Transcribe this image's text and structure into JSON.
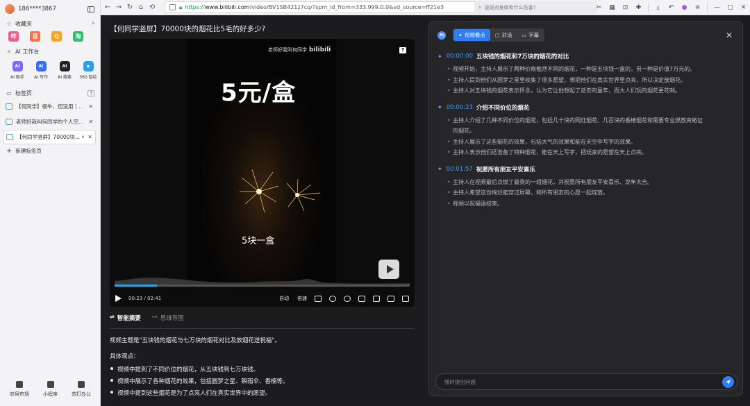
{
  "sidebar": {
    "user": "186****3867",
    "favorites_label": "收藏夹",
    "favorites": [
      {
        "icon": "bilibili-icon",
        "glyph": "哔",
        "color": "#f25d8e"
      },
      {
        "icon": "baidu-icon",
        "glyph": "百",
        "color": "#ff6f3d"
      },
      {
        "icon": "qq-icon",
        "glyph": "Q",
        "color": "#ffa21e"
      },
      {
        "icon": "taobao-icon",
        "glyph": "淘",
        "color": "#2fbf6a"
      }
    ],
    "ai_label": "AI 工作台",
    "ai_items": [
      {
        "label": "AI 助手",
        "glyph": "AI",
        "color": "#7b6cf6"
      },
      {
        "label": "AI 写作",
        "glyph": "AI",
        "color": "#3b6cf6"
      },
      {
        "label": "AI 搜索",
        "glyph": "AI",
        "color": "#222222"
      },
      {
        "label": "360 智绘",
        "glyph": "◆",
        "color": "#2b9ef0"
      }
    ],
    "tabs_label": "标签页",
    "tabs_count": "3",
    "tabs": [
      {
        "title": "【何同学】很牛，但没用丨...",
        "active": false
      },
      {
        "title": "老师好我叫何同学的个人空...",
        "active": false
      },
      {
        "title": "【何同学竖屏】70000块...",
        "active": true
      }
    ],
    "new_tab": "新建标签页",
    "bottom": [
      "应用市场",
      "小程序",
      "苏打办公"
    ]
  },
  "toolbar": {
    "url_https": "https://",
    "url_host": "www.bilibili.com",
    "url_rest": "/video/BV1SB421z7cq/?spm_id_from=333.999.0.0&vd_source=ff21e3",
    "search_placeholder": "说说对身体有什么伤害?"
  },
  "video": {
    "page_title": "【何同学竖屏】70000块的烟花比5毛的好多少?",
    "watermark": "老师好我叫何同学",
    "watermark_logo": "bilibili",
    "big_text": "5元/盒",
    "subtitle": "5块一盒",
    "time": "00:23 / 02:41",
    "progress": 0.143,
    "auto_label": "自动",
    "speed_label": "倍速"
  },
  "summary_tabs": [
    "智能摘要",
    "思维导图"
  ],
  "summary": {
    "theme": "视频主题是\"五块钱的烟花与七万块的烟花对比及放烟花送祝福\"。",
    "viewpoints_label": "具体观点：",
    "points": [
      "视频中提到了不同价位的烟花，从五块钱到七万块钱。",
      "视频中展示了各种烟花的效果，包括圆梦之星、瞬雨伞、香楠等。",
      "视频中提到这些烟花是为了点亮人们在真实世界中的愿望。"
    ]
  },
  "panel": {
    "logo": "AI",
    "tabs": [
      "视频看点",
      "对话",
      "字幕"
    ],
    "chapters": [
      {
        "time": "00:00:00",
        "title": "五块钱的烟花和7万块的烟花的对比",
        "points": [
          "视频开始，主持人展示了两种价格截然不同的烟花，一种是五块钱一盒的，另一种是价值7万元的。",
          "主持人提到他们从圆梦之星里收集了很多愿望，想把他们在真实世界里点亮，所以决定放烟花。",
          "主持人对五块钱的烟花表示怀念，认为它让他想起了逝去的童年，而大人们玩的烟花更花哨。"
        ]
      },
      {
        "time": "00:00:23",
        "title": "介绍不同价位的烟花",
        "points": [
          "主持人介绍了几种不同价位的烟花，包括几十块的网红烟花、几百块的香椿烟花和需要专业燃放资格证",
          "的烟花。",
          "主持人展示了这些烟花的效果，包括大气的效果和能在天空中写字的效果。",
          "主持人表示他们还准备了特种烟花，能在天上写字，把玩家的愿望在天上点亮。"
        ]
      },
      {
        "time": "00:01:57",
        "title": "祝愿所有朋友平安喜乐",
        "points": [
          "主持人在视频最后点燃了最贵的一组烟花，并祝愿所有朋友平安喜乐、龙年大吉。",
          "主持人希望这份绚烂能穿过屏幕，和所有朋友的心愿一起绽放。",
          "视频以祝福语结束。"
        ]
      }
    ],
    "ask_placeholder": "随时提出问题"
  }
}
